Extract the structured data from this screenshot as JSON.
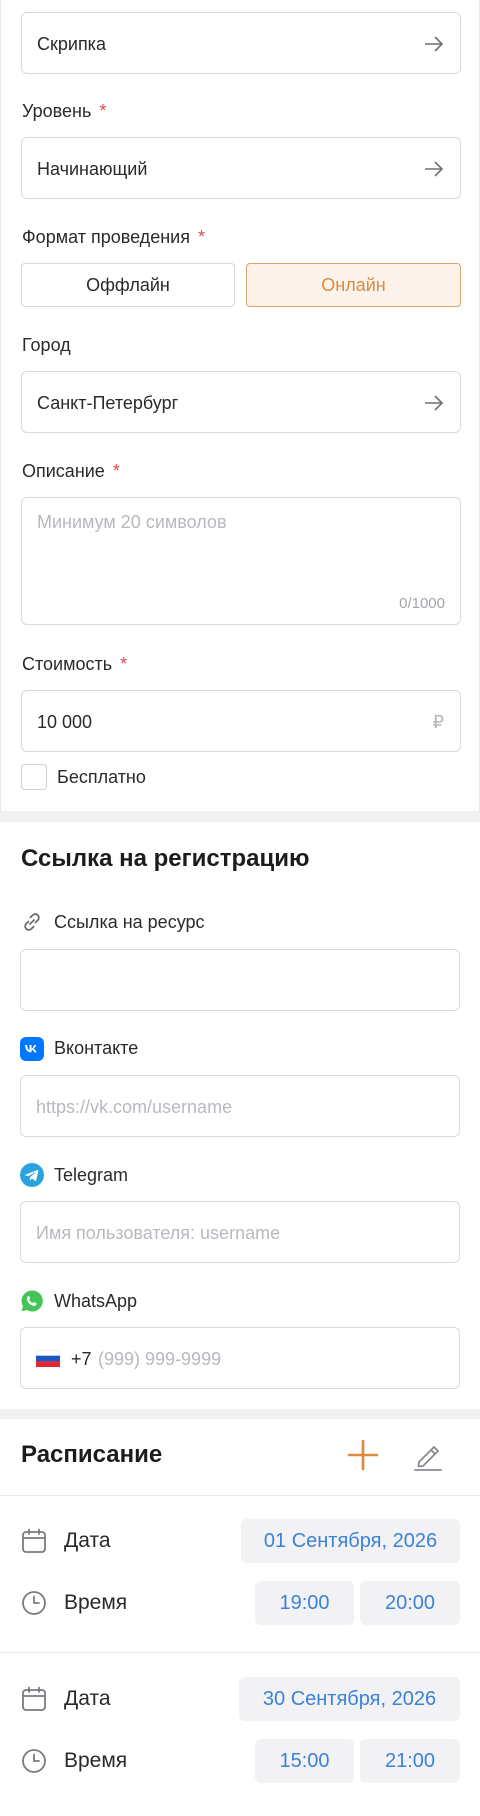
{
  "form": {
    "instrument_value": "Скрипка",
    "level_label": "Уровень",
    "level_value": "Начинающий",
    "format_label": "Формат проведения",
    "format_options": [
      "Оффлайн",
      "Онлайн"
    ],
    "format_selected": "Онлайн",
    "city_label": "Город",
    "city_value": "Санкт-Петербург",
    "description_label": "Описание",
    "description_placeholder": "Минимум 20 символов",
    "description_counter": "0/1000",
    "price_label": "Стоимость",
    "price_value": "10 000",
    "currency_symbol": "₽",
    "free_label": "Бесплатно",
    "required_mark": "*"
  },
  "links": {
    "title": "Ссылка на регистрацию",
    "resource_label": "Ссылка на ресурс",
    "resource_value": "",
    "vk_label": "Вконтакте",
    "vk_placeholder": "https://vk.com/username",
    "telegram_label": "Telegram",
    "telegram_placeholder": "Имя пользователя: username",
    "whatsapp_label": "WhatsApp",
    "whatsapp_prefix": "+7",
    "whatsapp_placeholder": "(999) 999-9999"
  },
  "schedule": {
    "title": "Расписание",
    "entries": [
      {
        "date_label": "Дата",
        "date": "01 Сентября, 2026",
        "time_label": "Время",
        "start": "19:00",
        "end": "20:00"
      },
      {
        "date_label": "Дата",
        "date": "30 Сентября, 2026",
        "time_label": "Время",
        "start": "15:00",
        "end": "21:00"
      }
    ]
  },
  "colors": {
    "accent": "#dd8a3e",
    "link_blue": "#3b82d6",
    "required": "#e5484d",
    "vk": "#0077ff",
    "telegram": "#2aa3de",
    "whatsapp": "#43c457"
  },
  "icons": [
    "arrow-right-icon",
    "link-icon",
    "vk-icon",
    "telegram-icon",
    "whatsapp-icon",
    "russia-flag-icon",
    "plus-icon",
    "pencil-icon",
    "calendar-icon",
    "clock-icon"
  ]
}
